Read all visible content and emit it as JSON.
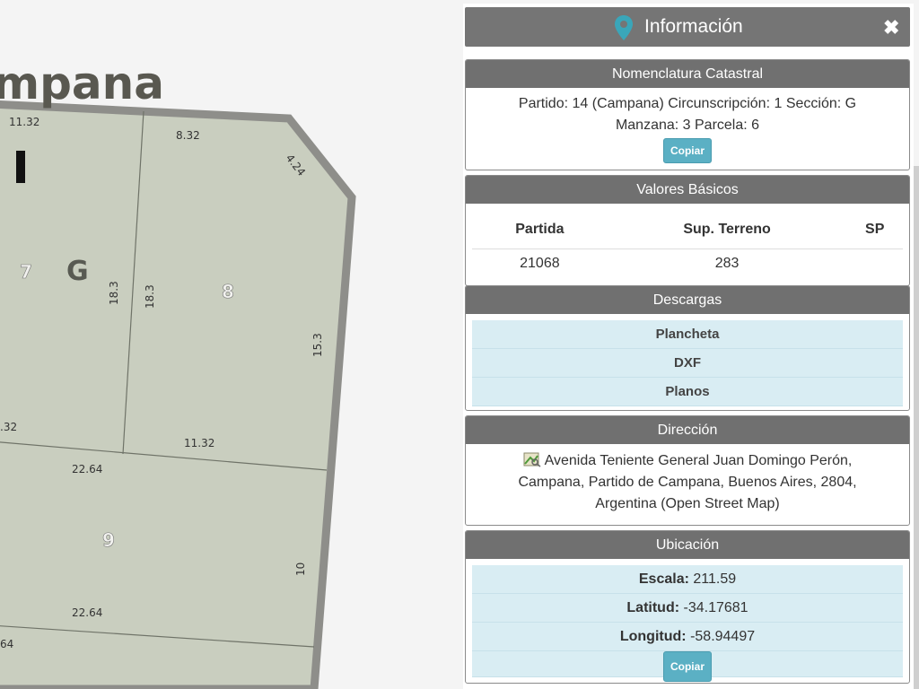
{
  "map": {
    "locality_label": "mpana",
    "block_letter": "G",
    "circ_numeral": "I",
    "parcels": [
      "7",
      "8",
      "9"
    ],
    "measures": [
      "11.32",
      "8.32",
      "4.24",
      "18.3",
      "18.3",
      "15.3",
      ".32",
      "11.32",
      "22.64",
      "10",
      "22.64",
      "64"
    ]
  },
  "panel": {
    "title": "Información",
    "close_symbol": "✖",
    "nomenclatura": {
      "heading": "Nomenclatura Catastral",
      "line1": "Partido: 14 (Campana) Circunscripción: 1 Sección: G",
      "line2": "Manzana: 3 Parcela: 6",
      "copy_label": "Copiar"
    },
    "valores": {
      "heading": "Valores Básicos",
      "columns": [
        "Partida",
        "Sup. Terreno",
        "SP"
      ],
      "row": [
        "21068",
        "283",
        ""
      ]
    },
    "descargas": {
      "heading": "Descargas",
      "items": [
        "Plancheta",
        "DXF",
        "Planos"
      ]
    },
    "direccion": {
      "heading": "Dirección",
      "line1": "Avenida Teniente General Juan Domingo Perón,",
      "line2": "Campana, Partido de Campana, Buenos Aires, 2804,",
      "line3": "Argentina (Open Street Map)"
    },
    "ubicacion": {
      "heading": "Ubicación",
      "escala_label": "Escala:",
      "escala_value": "211.59",
      "latitud_label": "Latitud:",
      "latitud_value": "-34.17681",
      "longitud_label": "Longitud:",
      "longitud_value": "-58.94497",
      "copy_label": "Copiar"
    }
  },
  "colors": {
    "parcel_fill": "#c9cebf",
    "block_border": "#8e8e8a",
    "header_bg": "#757575",
    "row_bg": "#d9edf3",
    "button_bg": "#5bb0c4",
    "pin": "#3aa6b9"
  }
}
